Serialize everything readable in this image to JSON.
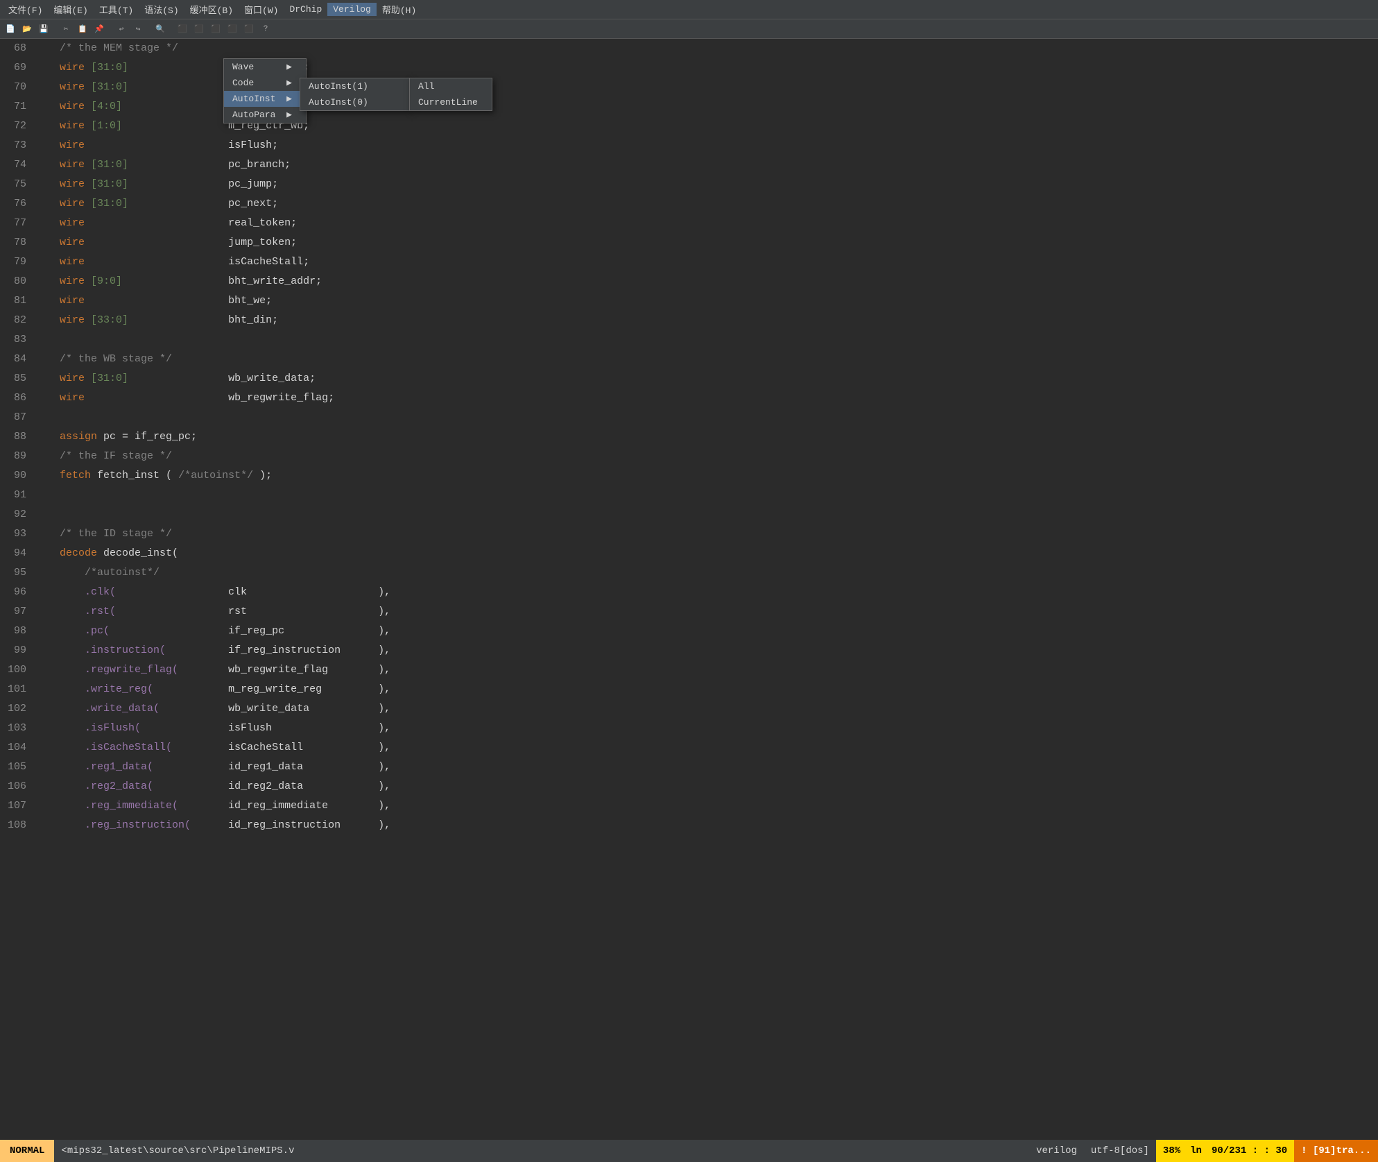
{
  "menubar": {
    "items": [
      "文件(F)",
      "编辑(E)",
      "工具(T)",
      "语法(S)",
      "缓冲区(B)",
      "窗口(W)",
      "DrChip",
      "Verilog",
      "帮助(H)"
    ]
  },
  "verilog_menu": {
    "items": [
      {
        "label": "Wave",
        "has_arrow": true
      },
      {
        "label": "Code",
        "has_arrow": true
      },
      {
        "label": "AutoInst",
        "has_arrow": true,
        "highlighted": true
      },
      {
        "label": "AutoPara",
        "has_arrow": true
      }
    ]
  },
  "autoinst_submenu": {
    "items": [
      {
        "label": "AutoInst(1)",
        "has_arrow": true
      },
      {
        "label": "AutoInst(0)",
        "has_arrow": false
      }
    ]
  },
  "autoinst_right_submenu": {
    "items": [
      {
        "label": "All"
      },
      {
        "label": "CurrentLine"
      }
    ]
  },
  "code_lines": [
    {
      "num": "68",
      "content": "    /* the MEM stage */"
    },
    {
      "num": "69",
      "content": "    wire [31:0]                m_reg_em_out;"
    },
    {
      "num": "70",
      "content": "    wire [31:0]                m_reg_ALU_out;"
    },
    {
      "num": "71",
      "content": "    wire [4:0]                 m_reg_write_reg;"
    },
    {
      "num": "72",
      "content": "    wire [1:0]                 m_reg_ctr_wb;"
    },
    {
      "num": "73",
      "content": "    wire                       isFlush;"
    },
    {
      "num": "74",
      "content": "    wire [31:0]                pc_branch;"
    },
    {
      "num": "75",
      "content": "    wire [31:0]                pc_jump;"
    },
    {
      "num": "76",
      "content": "    wire [31:0]                pc_next;"
    },
    {
      "num": "77",
      "content": "    wire                       real_token;"
    },
    {
      "num": "78",
      "content": "    wire                       jump_token;"
    },
    {
      "num": "79",
      "content": "    wire                       isCacheStall;"
    },
    {
      "num": "80",
      "content": "    wire [9:0]                 bht_write_addr;"
    },
    {
      "num": "81",
      "content": "    wire                       bht_we;"
    },
    {
      "num": "82",
      "content": "    wire [33:0]                bht_din;"
    },
    {
      "num": "83",
      "content": ""
    },
    {
      "num": "84",
      "content": "    /* the WB stage */"
    },
    {
      "num": "85",
      "content": "    wire [31:0]                wb_write_data;"
    },
    {
      "num": "86",
      "content": "    wire                       wb_regwrite_flag;"
    },
    {
      "num": "87",
      "content": ""
    },
    {
      "num": "88",
      "content": "    assign pc = if_reg_pc;"
    },
    {
      "num": "89",
      "content": "    /* the IF stage */"
    },
    {
      "num": "90",
      "content": "    fetch fetch_inst ( /*autoinst*/ );"
    },
    {
      "num": "91",
      "content": ""
    },
    {
      "num": "92",
      "content": ""
    },
    {
      "num": "93",
      "content": "    /* the ID stage */"
    },
    {
      "num": "94",
      "content": "    decode decode_inst("
    },
    {
      "num": "95",
      "content": "        /*autoinst*/"
    },
    {
      "num": "96",
      "content": "        .clk(                  clk                     ),"
    },
    {
      "num": "97",
      "content": "        .rst(                  rst                     ),"
    },
    {
      "num": "98",
      "content": "        .pc(                   if_reg_pc               ),"
    },
    {
      "num": "99",
      "content": "        .instruction(          if_reg_instruction      ),"
    },
    {
      "num": "100",
      "content": "        .regwrite_flag(        wb_regwrite_flag        ),"
    },
    {
      "num": "101",
      "content": "        .write_reg(            m_reg_write_reg         ),"
    },
    {
      "num": "102",
      "content": "        .write_data(           wb_write_data           ),"
    },
    {
      "num": "103",
      "content": "        .isFlush(              isFlush                 ),"
    },
    {
      "num": "104",
      "content": "        .isCacheStall(         isCacheStall            ),"
    },
    {
      "num": "105",
      "content": "        .reg1_data(            id_reg1_data            ),"
    },
    {
      "num": "106",
      "content": "        .reg2_data(            id_reg2_data            ),"
    },
    {
      "num": "107",
      "content": "        .reg_immediate(        id_reg_immediate        ),"
    },
    {
      "num": "108",
      "content": "        .reg_instruction(      id_reg_instruction      ),"
    }
  ],
  "statusbar": {
    "mode": "NORMAL",
    "file": "<mips32_latest\\source\\src\\PipelineMIPS.v",
    "type": "verilog",
    "encoding": "utf-8[dos]",
    "percent": "38%",
    "ln_label": "ln",
    "position": "90/231 : : 30",
    "warn": "! [91]tra..."
  }
}
